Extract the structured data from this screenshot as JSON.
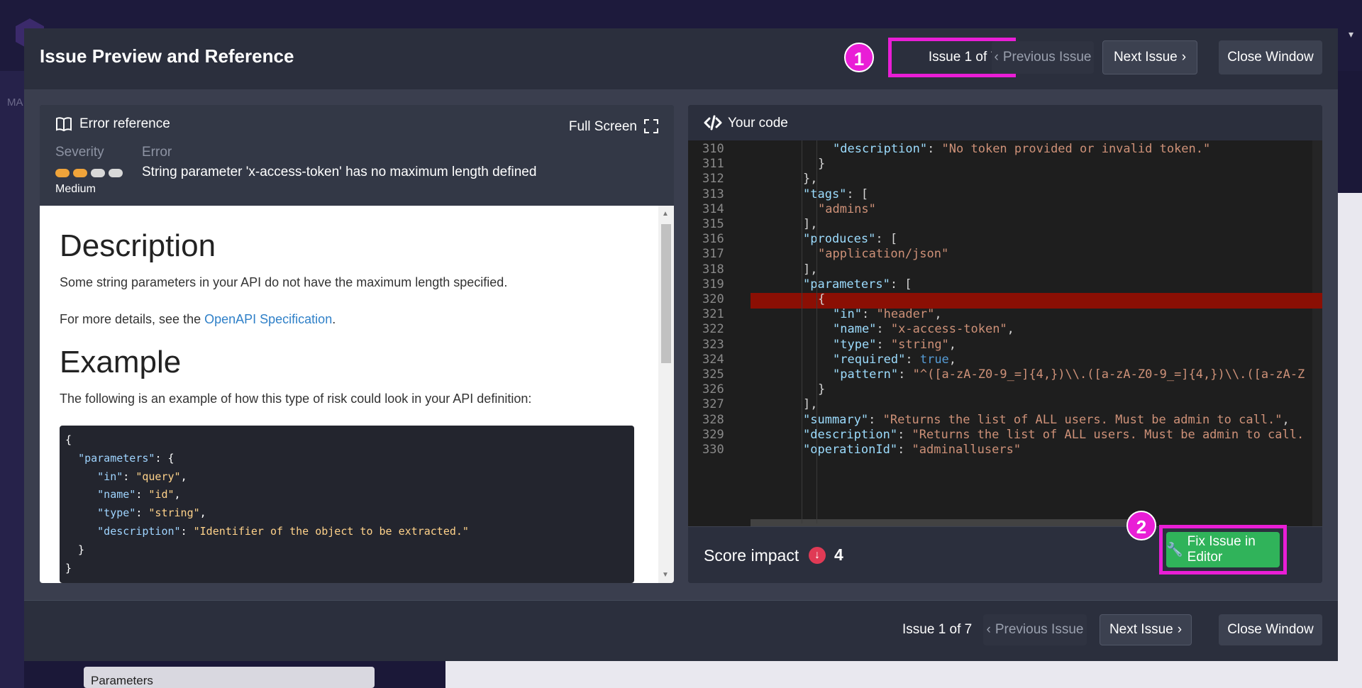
{
  "background": {
    "sidebar_label": "MA",
    "parameters_label": "Parameters",
    "medium_label": "Medium"
  },
  "modal": {
    "title": "Issue Preview and Reference",
    "markers": {
      "one": "1",
      "two": "2"
    },
    "header": {
      "issue_counter": "Issue 1 of 7",
      "previous_label": "Previous Issue",
      "next_label": "Next Issue",
      "close_label": "Close Window"
    },
    "footer": {
      "issue_counter": "Issue 1 of 7",
      "previous_label": "Previous Issue",
      "next_label": "Next Issue",
      "close_label": "Close Window"
    }
  },
  "error_reference": {
    "title": "Error reference",
    "full_screen_label": "Full Screen",
    "severity_label": "Severity",
    "error_label": "Error",
    "severity_value": "Medium",
    "severity_level": 2,
    "severity_max": 4,
    "severity_colors": {
      "active": "#f0a43a",
      "inactive": "#d8d8d8"
    },
    "error_text": "String parameter 'x-access-token' has no maximum length defined",
    "description_heading": "Description",
    "description_text": "Some string parameters in your API do not have the maximum length specified.",
    "details_prefix": "For more details, see the ",
    "details_link": "OpenAPI Specification",
    "details_suffix": ".",
    "example_heading": "Example",
    "example_text": "The following is an example of how this type of risk could look in your API definition:"
  },
  "your_code": {
    "title": "Your code",
    "highlight_color": "#8b0f04",
    "lines": [
      {
        "n": "310",
        "indent": 6,
        "parts": [
          [
            "k",
            "\"description\""
          ],
          [
            "p",
            ": "
          ],
          [
            "s",
            "\"No token provided or invalid token.\""
          ]
        ]
      },
      {
        "n": "311",
        "indent": 5,
        "parts": [
          [
            "p",
            "}"
          ]
        ]
      },
      {
        "n": "312",
        "indent": 4,
        "parts": [
          [
            "p",
            "},"
          ]
        ]
      },
      {
        "n": "313",
        "indent": 4,
        "parts": [
          [
            "k",
            "\"tags\""
          ],
          [
            "p",
            ": ["
          ]
        ]
      },
      {
        "n": "314",
        "indent": 5,
        "parts": [
          [
            "s",
            "\"admins\""
          ]
        ]
      },
      {
        "n": "315",
        "indent": 4,
        "parts": [
          [
            "p",
            "],"
          ]
        ]
      },
      {
        "n": "316",
        "indent": 4,
        "parts": [
          [
            "k",
            "\"produces\""
          ],
          [
            "p",
            ": ["
          ]
        ]
      },
      {
        "n": "317",
        "indent": 5,
        "parts": [
          [
            "s",
            "\"application/json\""
          ]
        ]
      },
      {
        "n": "318",
        "indent": 4,
        "parts": [
          [
            "p",
            "],"
          ]
        ]
      },
      {
        "n": "319",
        "indent": 4,
        "parts": [
          [
            "k",
            "\"parameters\""
          ],
          [
            "p",
            ": ["
          ]
        ]
      },
      {
        "n": "320",
        "indent": 5,
        "parts": [
          [
            "p",
            "{"
          ]
        ],
        "highlight": true
      },
      {
        "n": "321",
        "indent": 6,
        "parts": [
          [
            "k",
            "\"in\""
          ],
          [
            "p",
            ": "
          ],
          [
            "s",
            "\"header\""
          ],
          [
            "p",
            ","
          ]
        ]
      },
      {
        "n": "322",
        "indent": 6,
        "parts": [
          [
            "k",
            "\"name\""
          ],
          [
            "p",
            ": "
          ],
          [
            "s",
            "\"x-access-token\""
          ],
          [
            "p",
            ","
          ]
        ]
      },
      {
        "n": "323",
        "indent": 6,
        "parts": [
          [
            "k",
            "\"type\""
          ],
          [
            "p",
            ": "
          ],
          [
            "s",
            "\"string\""
          ],
          [
            "p",
            ","
          ]
        ]
      },
      {
        "n": "324",
        "indent": 6,
        "parts": [
          [
            "k",
            "\"required\""
          ],
          [
            "p",
            ": "
          ],
          [
            "b",
            "true"
          ],
          [
            "p",
            ","
          ]
        ]
      },
      {
        "n": "325",
        "indent": 6,
        "parts": [
          [
            "k",
            "\"pattern\""
          ],
          [
            "p",
            ": "
          ],
          [
            "s",
            "\"^([a-zA-Z0-9_=]{4,})\\\\.([a-zA-Z0-9_=]{4,})\\\\.([a-zA-Z"
          ]
        ]
      },
      {
        "n": "326",
        "indent": 5,
        "parts": [
          [
            "p",
            "}"
          ]
        ]
      },
      {
        "n": "327",
        "indent": 4,
        "parts": [
          [
            "p",
            "],"
          ]
        ]
      },
      {
        "n": "328",
        "indent": 4,
        "parts": [
          [
            "k",
            "\"summary\""
          ],
          [
            "p",
            ": "
          ],
          [
            "s",
            "\"Returns the list of ALL users. Must be admin to call.\""
          ],
          [
            "p",
            ","
          ]
        ]
      },
      {
        "n": "329",
        "indent": 4,
        "parts": [
          [
            "k",
            "\"description\""
          ],
          [
            "p",
            ": "
          ],
          [
            "s",
            "\"Returns the list of ALL users. Must be admin to call."
          ]
        ]
      },
      {
        "n": "330",
        "indent": 4,
        "parts": [
          [
            "k",
            "\"operationId\""
          ],
          [
            "p",
            ": "
          ],
          [
            "s",
            "\"adminallusers\""
          ]
        ]
      }
    ],
    "score_label": "Score impact",
    "score_value": "4",
    "fix_label": "Fix Issue in Editor"
  }
}
